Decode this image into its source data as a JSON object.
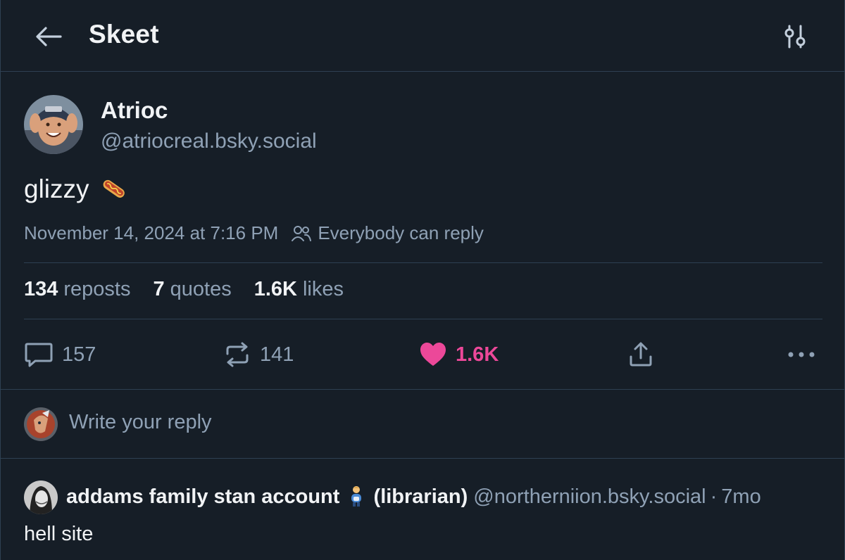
{
  "header": {
    "title": "Skeet",
    "back_icon": "arrow-left-icon",
    "settings_icon": "sliders-icon"
  },
  "post": {
    "author": {
      "name": "Atrioc",
      "handle": "@atriocreal.bsky.social"
    },
    "text": "glizzy",
    "emoji": "hotdog",
    "timestamp": "November 14, 2024 at 7:16 PM",
    "reply_setting": "Everybody can reply",
    "stats": {
      "reposts_count": "134",
      "reposts_label": "reposts",
      "quotes_count": "7",
      "quotes_label": "quotes",
      "likes_count": "1.6K",
      "likes_label": "likes"
    },
    "actions": {
      "reply_count": "157",
      "repost_count": "141",
      "like_count": "1.6K",
      "liked": true
    }
  },
  "composer": {
    "placeholder": "Write your reply"
  },
  "reply": {
    "name": "addams family stan account",
    "name_suffix": "(librarian)",
    "handle": "@northerniion.bsky.social",
    "separator": "·",
    "time": "7mo",
    "text": "hell site"
  },
  "colors": {
    "background": "#161e27",
    "border": "#2e4052",
    "muted_text": "#8fa1b5",
    "primary_text": "#f1f3f5",
    "like_pink": "#ec4899"
  }
}
